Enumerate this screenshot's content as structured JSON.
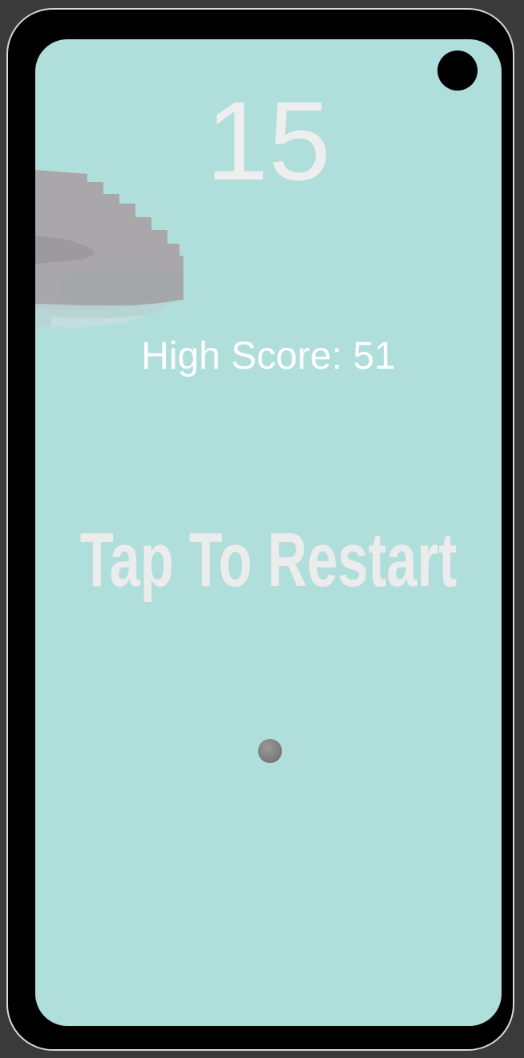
{
  "game": {
    "score": "15",
    "high_score_text": "High Score: 51",
    "restart_text": "Tap To Restart",
    "background_color": "#afdedb",
    "text_color": "#eeeeee",
    "ball_color": "#808080",
    "platform_color": "#aaa7aa"
  }
}
